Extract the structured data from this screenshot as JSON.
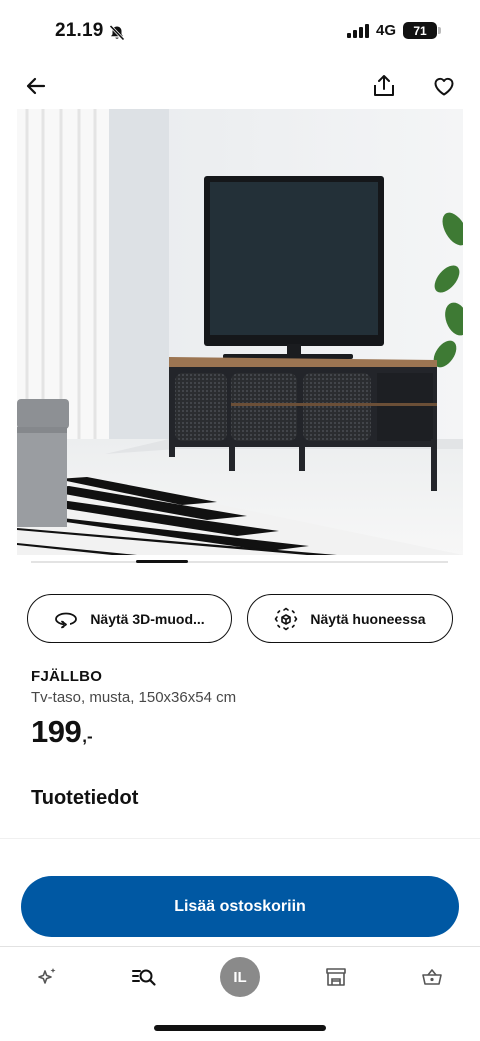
{
  "status": {
    "time": "21.19",
    "network": "4G",
    "battery": "71"
  },
  "colors": {
    "accent": "#0058a3",
    "text": "#111111",
    "muted": "#484848"
  },
  "icons": {
    "back": "arrow-left-icon",
    "share": "share-icon",
    "favourite": "heart-icon",
    "view_3d": "rotate-3d-icon",
    "view_room": "ar-cube-icon",
    "tabs": [
      "sparkle-icon",
      "search-icon",
      "avatar",
      "store-icon",
      "basket-icon"
    ]
  },
  "product": {
    "name": "FJÄLLBO",
    "description": "Tv-taso, musta, 150x36x54 cm",
    "price": "199",
    "price_suffix": ",-"
  },
  "actions": {
    "view_3d_label": "Näytä 3D-muod...",
    "view_room_label": "Näytä huoneessa",
    "add_to_cart_label": "Lisää ostoskoriin"
  },
  "details": {
    "title": "Tuotetiedot"
  },
  "tabbar": {
    "avatar_initials": "IL",
    "active_index": 1
  }
}
